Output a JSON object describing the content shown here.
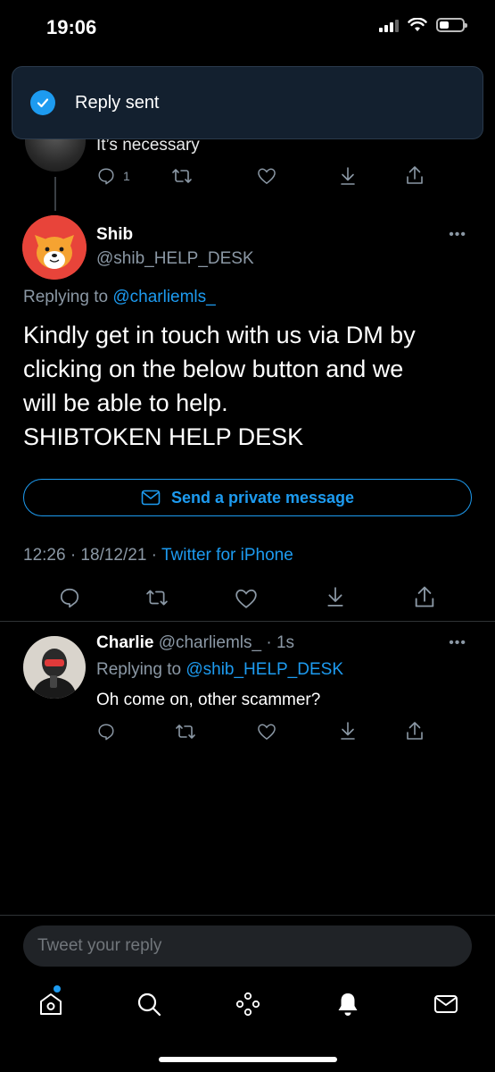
{
  "status": {
    "time": "19:06"
  },
  "toast": {
    "text": "Reply sent"
  },
  "previous_tweet": {
    "text": "It’s necessary",
    "reply_count": "1"
  },
  "main_tweet": {
    "name": "Shib",
    "handle": "@shib_HELP_DESK",
    "replying_prefix": "Replying to ",
    "replying_to": "@charliemls_",
    "lines": [
      "Kindly get in touch with us via DM by",
      "clicking on the below button and we",
      "will be able to help.",
      "SHIBTOKEN HELP DESK"
    ],
    "dm_button": "Send a private message",
    "timestamp": "12:26 · 18/12/21 · ",
    "source": "Twitter for iPhone"
  },
  "reply_tweet": {
    "name": "Charlie",
    "handle_time": " @charliemls_ · 1s",
    "replying_prefix": "Replying to ",
    "replying_to": "@shib_HELP_DESK",
    "text": "Oh come on, other scammer?"
  },
  "compose": {
    "placeholder": "Tweet your reply"
  },
  "colors": {
    "accent": "#1d9bf0",
    "background": "#000000",
    "muted": "#8b98a5"
  }
}
